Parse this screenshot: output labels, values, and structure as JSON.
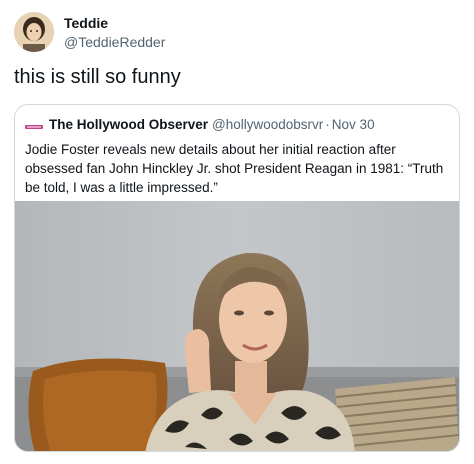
{
  "tweet": {
    "author_name": "Teddie",
    "author_handle": "@TeddieRedder",
    "text": "this is still so funny",
    "avatar_icon": "profile-photo"
  },
  "quoted_tweet": {
    "author_name": "The Hollywood Observer",
    "author_handle": "@hollywoodobsrvr",
    "separator": "·",
    "date": "Nov 30",
    "text": "Jodie Foster reveals new details about her initial reaction after obsessed fan John Hinckley Jr. shot President Reagan in 1981: “Truth be told, I was a little impressed.”",
    "media_icon": "video-still-woman-on-sofa"
  },
  "colors": {
    "text_primary": "#0f1419",
    "text_secondary": "#536471",
    "border": "#cfd9de"
  }
}
